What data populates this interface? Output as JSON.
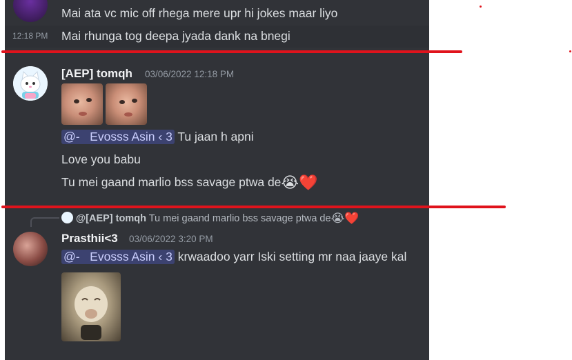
{
  "messages": {
    "top_line_1": "Mai ata vc mic off rhega mere upr hi jokes maar liyo",
    "top_line_2": "Mai rhunga tog deepa jyada dank na bnegi",
    "top_line_2_time": "12:18 PM"
  },
  "msg_tomqh": {
    "username": "[AEP] tomqh",
    "timestamp": "03/06/2022 12:18 PM",
    "mention": "@-   Evosss Asin ‹ 3",
    "line_1_text": "Tu jaan h apni",
    "line_2": "Love you babu",
    "line_3": "Tu mei gaand marlio bss savage ptwa de",
    "emoji_cry": "😭",
    "emoji_heart": "❤️"
  },
  "reply": {
    "username": "@[AEP] tomqh",
    "text": "Tu mei gaand marlio bss savage ptwa de",
    "emoji_cry": "😭",
    "emoji_heart": "❤️"
  },
  "msg_prasthii": {
    "username": "Prasthii<3",
    "timestamp": "03/06/2022 3:20 PM",
    "mention": "@-   Evosss Asin ‹ 3",
    "text": "krwaadoo yarr Iski setting mr naa jaaye kal"
  },
  "colors": {
    "background": "#313338",
    "text": "#dbdee1",
    "mention_bg": "#3c4270",
    "annotation_red": "#e0131c"
  }
}
